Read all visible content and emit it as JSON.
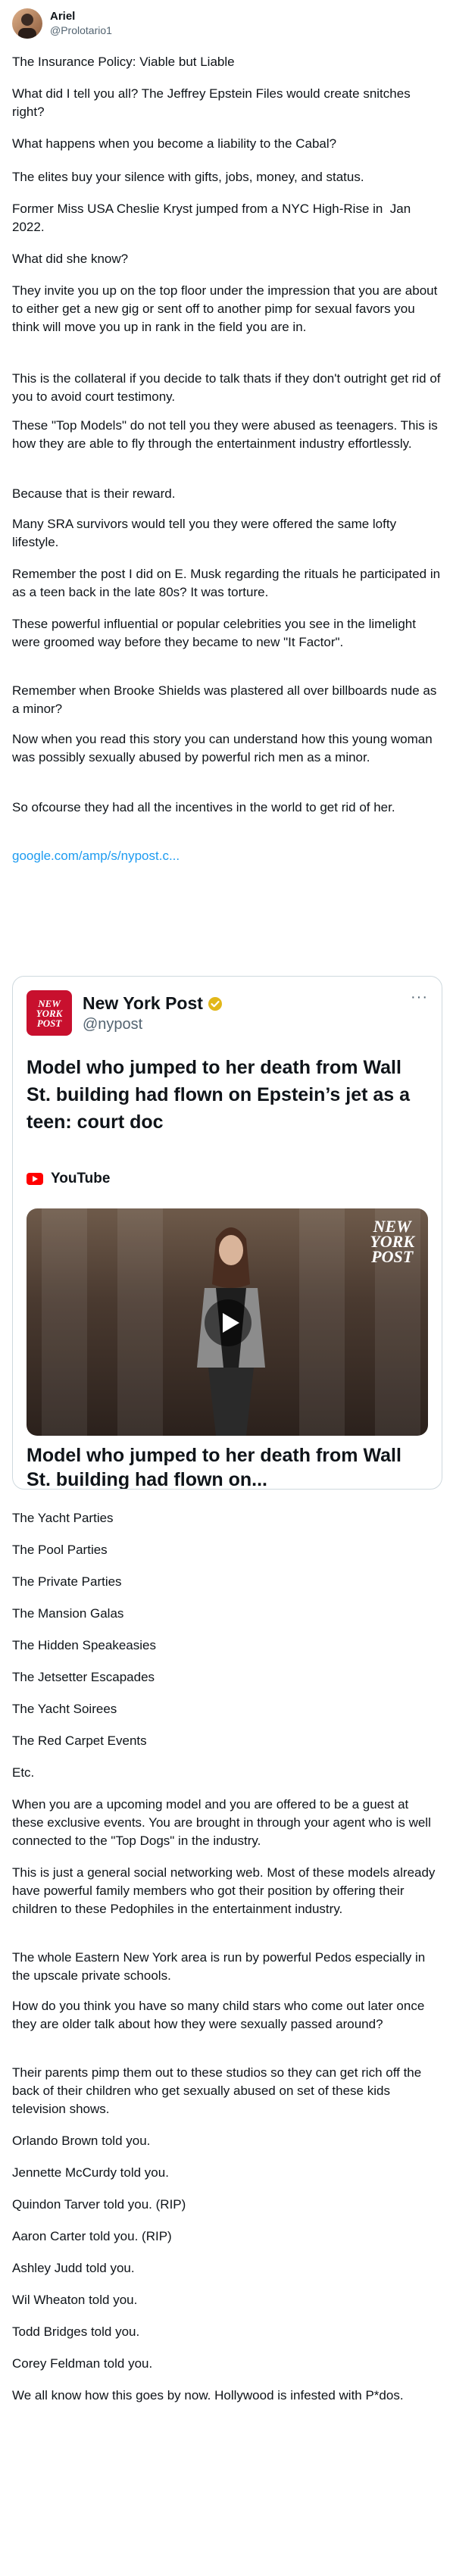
{
  "author": {
    "name": "Ariel",
    "handle": "@Prolotario1"
  },
  "paragraphs_top": [
    "The Insurance Policy: Viable but Liable",
    "What did I tell you all? The Jeffrey Epstein Files would create snitches right?",
    "What happens when you become a liability to the Cabal?",
    "The elites buy your silence with gifts, jobs, money, and status.",
    "Former Miss USA Cheslie Kryst jumped from a NYC High-Rise in  Jan 2022.",
    "What did she know?",
    "They invite you up on the top floor under the impression that you are about to either get a new gig or sent off to another pimp for sexual favors you think will move you up in rank in the field you are in.",
    "This is the collateral if you decide to talk thats if they don't outright get rid of you to avoid court testimony.",
    "These \"Top Models\" do not tell you they were abused as teenagers. This is how they are able to fly through the entertainment industry effortlessly.",
    "Because that is their reward.",
    "Many SRA survivors would tell you they were offered the same lofty lifestyle.",
    "Remember the post I did on E. Musk regarding the rituals he participated in as a teen back in the late 80s? It was torture.",
    "These powerful influential or popular celebrities you see in the limelight were groomed way before they became to new \"It Factor\".",
    "Remember when Brooke Shields was plastered all over billboards nude as a minor?",
    "Now when you read this story you can understand how this young woman was possibly sexually abused by powerful rich men as a minor.",
    "So ofcourse they had all the incentives in the world to get rid of her."
  ],
  "link": "google.com/amp/s/nypost.c...",
  "card": {
    "source_name": "New York Post",
    "source_handle": "@nypost",
    "logo_text": [
      "NEW",
      "YORK",
      "POST"
    ],
    "title": "Model who jumped to her death from Wall St. building had flown on Epstein’s jet as a teen: court doc",
    "platform": "YouTube",
    "video_title": "Model who jumped to her death from Wall St. building had flown on..."
  },
  "paragraphs_bottom": [
    "The Yacht Parties",
    "The Pool Parties",
    "The Private Parties",
    "The Mansion Galas",
    "The Hidden Speakeasies",
    "The Jetsetter Escapades",
    "The Yacht Soirees",
    "The Red Carpet Events",
    "Etc.",
    "When you are a upcoming model and you are offered to be a guest at these exclusive events. You are brought in through your agent who is well connected to the \"Top Dogs\" in the industry.",
    "This is just a general social networking web. Most of these models already have powerful family members who got their position by offering their children to these Pedophiles in the entertainment industry.",
    "The whole Eastern New York area is run by powerful Pedos especially in the upscale private schools.",
    "How do you think you have so many child stars who come out later once they are older talk about how they were sexually passed around?",
    "Their parents pimp them out to these studios so they can get rich off the back of their children who get sexually abused on set of these kids television shows.",
    "Orlando Brown told you.",
    "Jennette McCurdy told you.",
    "Quindon Tarver told you. (RIP)",
    "Aaron Carter told you. (RIP)",
    "Ashley Judd told you.",
    "Wil Wheaton told you.",
    "Todd Bridges told you.",
    "Corey Feldman told you.",
    "We all know how this goes by now. Hollywood is infested with P*dos."
  ],
  "colors": {
    "link": "#1d9bf0",
    "text": "#0f1419",
    "muted": "#536471",
    "nypost_red": "#c8102e",
    "youtube_red": "#ff0000"
  }
}
